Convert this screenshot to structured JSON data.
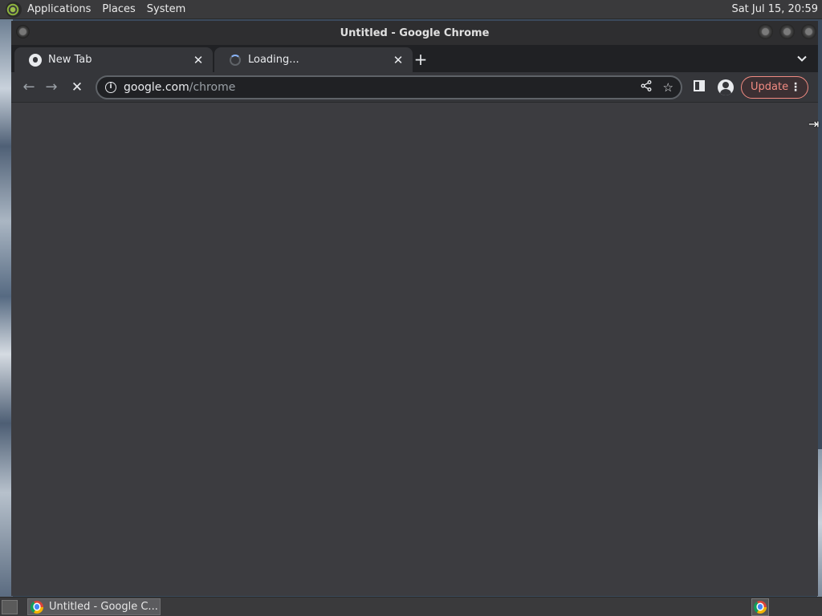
{
  "top_panel": {
    "menus": [
      "Applications",
      "Places",
      "System"
    ],
    "clock": "Sat Jul 15, 20:59"
  },
  "window": {
    "title": "Untitled - Google Chrome"
  },
  "tabs": [
    {
      "label": "New Tab",
      "favicon": "chrome-icon",
      "close": "✕"
    },
    {
      "label": "Loading...",
      "favicon": "loading-spinner",
      "close": "✕"
    }
  ],
  "tabstrip": {
    "new_tab": "+",
    "tab_search": "⌄"
  },
  "toolbar": {
    "back": "←",
    "forward": "→",
    "stop": "✕",
    "url_host": "google.com",
    "url_path": "/chrome",
    "info": "i",
    "share": "⪪",
    "bookmark": "☆",
    "side_panel": "◧",
    "update_label": "Update",
    "menu": "⋮"
  },
  "taskbar": {
    "task_label": "Untitled - Google C..."
  },
  "colors": {
    "panel_bg": "#3a3a3c",
    "titlebar_bg": "#2e2e30",
    "tabstrip_bg": "#202124",
    "toolbar_bg": "#35363a",
    "content_bg": "#3c3c40",
    "update_accent": "#f28b82"
  }
}
